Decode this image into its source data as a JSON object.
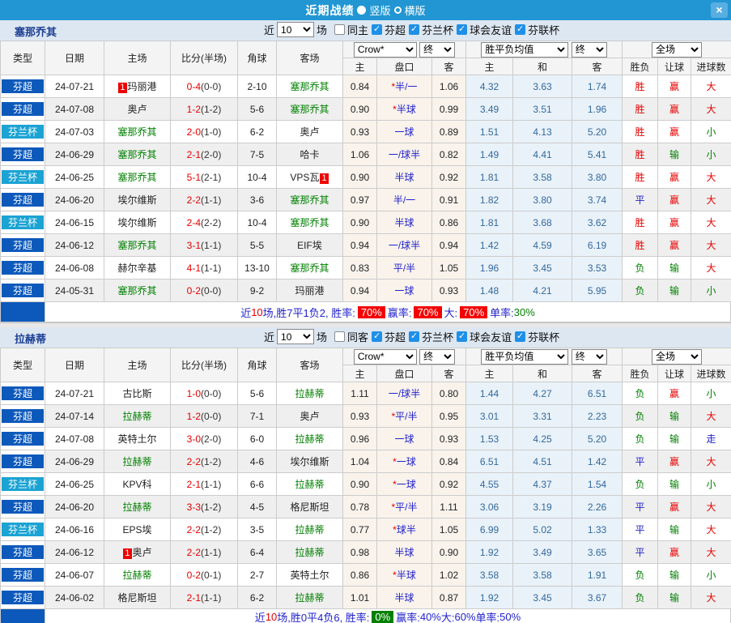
{
  "titlebar": {
    "title": "近期战绩",
    "radio_selected_label": "竖版",
    "radio_unselected_label": "横版",
    "close_label": "×"
  },
  "filter": {
    "near": "近",
    "rounds": "10",
    "matches": "场",
    "leagues": [
      "芬超",
      "芬兰杯",
      "球会友谊",
      "芬联杯"
    ]
  },
  "cols": {
    "type": "类型",
    "date": "日期",
    "home": "主场",
    "score": "比分(半场)",
    "corner": "角球",
    "away": "客场",
    "crow_option": "Crow*",
    "final_option": "终",
    "avg_option": "胜平负均值",
    "scope_option": "全场",
    "odds_home": "主",
    "handicap": "盘口",
    "odds_away": "客",
    "avg_home": "主",
    "avg_draw": "和",
    "avg_away": "客",
    "result": "胜负",
    "let_ball": "让球",
    "goals": "进球数"
  },
  "sections": [
    {
      "team": "塞那乔其",
      "same_side_label": "同主",
      "rows": [
        {
          "lg": "芬超",
          "lgc": "super",
          "date": "24-07-21",
          "home": "玛丽港",
          "home_green": false,
          "home_badge": "before",
          "score": "0-4",
          "half": "(0-0)",
          "corner": "2-10",
          "away": "塞那乔其",
          "away_green": true,
          "away_badge": null,
          "o1": "0.84",
          "star": true,
          "hc": "半/一",
          "o2": "1.06",
          "m1": "4.32",
          "m2": "3.63",
          "m3": "1.74",
          "res": "胜",
          "lr": "赢",
          "gr": "大"
        },
        {
          "lg": "芬超",
          "lgc": "super",
          "date": "24-07-08",
          "home": "奥卢",
          "home_green": false,
          "home_badge": null,
          "score": "1-2",
          "half": "(1-2)",
          "corner": "5-6",
          "away": "塞那乔其",
          "away_green": true,
          "away_badge": null,
          "o1": "0.90",
          "star": true,
          "hc": "半球",
          "o2": "0.99",
          "m1": "3.49",
          "m2": "3.51",
          "m3": "1.96",
          "res": "胜",
          "lr": "赢",
          "gr": "大"
        },
        {
          "lg": "芬兰杯",
          "lgc": "cup",
          "date": "24-07-03",
          "home": "塞那乔其",
          "home_green": true,
          "home_badge": null,
          "score": "2-0",
          "half": "(1-0)",
          "corner": "6-2",
          "away": "奥卢",
          "away_green": false,
          "away_badge": null,
          "o1": "0.93",
          "star": false,
          "hc": "一球",
          "o2": "0.89",
          "m1": "1.51",
          "m2": "4.13",
          "m3": "5.20",
          "res": "胜",
          "lr": "赢",
          "gr": "小"
        },
        {
          "lg": "芬超",
          "lgc": "super",
          "date": "24-06-29",
          "home": "塞那乔其",
          "home_green": true,
          "home_badge": null,
          "score": "2-1",
          "half": "(2-0)",
          "corner": "7-5",
          "away": "哈卡",
          "away_green": false,
          "away_badge": null,
          "o1": "1.06",
          "star": false,
          "hc": "一/球半",
          "o2": "0.82",
          "m1": "1.49",
          "m2": "4.41",
          "m3": "5.41",
          "res": "胜",
          "lr": "输",
          "gr": "小"
        },
        {
          "lg": "芬兰杯",
          "lgc": "cup",
          "date": "24-06-25",
          "home": "塞那乔其",
          "home_green": true,
          "home_badge": null,
          "score": "5-1",
          "half": "(2-1)",
          "corner": "10-4",
          "away": "VPS瓦",
          "away_green": false,
          "away_badge": "after",
          "o1": "0.90",
          "star": false,
          "hc": "半球",
          "o2": "0.92",
          "m1": "1.81",
          "m2": "3.58",
          "m3": "3.80",
          "res": "胜",
          "lr": "赢",
          "gr": "大"
        },
        {
          "lg": "芬超",
          "lgc": "super",
          "date": "24-06-20",
          "home": "埃尔维斯",
          "home_green": false,
          "home_badge": null,
          "score": "2-2",
          "half": "(1-1)",
          "corner": "3-6",
          "away": "塞那乔其",
          "away_green": true,
          "away_badge": null,
          "o1": "0.97",
          "star": false,
          "hc": "半/一",
          "o2": "0.91",
          "m1": "1.82",
          "m2": "3.80",
          "m3": "3.74",
          "res": "平",
          "lr": "赢",
          "gr": "大"
        },
        {
          "lg": "芬兰杯",
          "lgc": "cup",
          "date": "24-06-15",
          "home": "埃尔维斯",
          "home_green": false,
          "home_badge": null,
          "score": "2-4",
          "half": "(2-2)",
          "corner": "10-4",
          "away": "塞那乔其",
          "away_green": true,
          "away_badge": null,
          "o1": "0.90",
          "star": false,
          "hc": "半球",
          "o2": "0.86",
          "m1": "1.81",
          "m2": "3.68",
          "m3": "3.62",
          "res": "胜",
          "lr": "赢",
          "gr": "大"
        },
        {
          "lg": "芬超",
          "lgc": "super",
          "date": "24-06-12",
          "home": "塞那乔其",
          "home_green": true,
          "home_badge": null,
          "score": "3-1",
          "half": "(1-1)",
          "corner": "5-5",
          "away": "EIF埃",
          "away_green": false,
          "away_badge": null,
          "o1": "0.94",
          "star": false,
          "hc": "一/球半",
          "o2": "0.94",
          "m1": "1.42",
          "m2": "4.59",
          "m3": "6.19",
          "res": "胜",
          "lr": "赢",
          "gr": "大"
        },
        {
          "lg": "芬超",
          "lgc": "super",
          "date": "24-06-08",
          "home": "赫尔辛基",
          "home_green": false,
          "home_badge": null,
          "score": "4-1",
          "half": "(1-1)",
          "corner": "13-10",
          "away": "塞那乔其",
          "away_green": true,
          "away_badge": null,
          "o1": "0.83",
          "star": false,
          "hc": "平/半",
          "o2": "1.05",
          "m1": "1.96",
          "m2": "3.45",
          "m3": "3.53",
          "res": "负",
          "lr": "输",
          "gr": "大"
        },
        {
          "lg": "芬超",
          "lgc": "super",
          "date": "24-05-31",
          "home": "塞那乔其",
          "home_green": true,
          "home_badge": null,
          "score": "0-2",
          "half": "(0-0)",
          "corner": "9-2",
          "away": "玛丽港",
          "away_green": false,
          "away_badge": null,
          "o1": "0.94",
          "star": false,
          "hc": "一球",
          "o2": "0.93",
          "m1": "1.48",
          "m2": "4.21",
          "m3": "5.95",
          "res": "负",
          "lr": "输",
          "gr": "小"
        }
      ],
      "summary": [
        {
          "t": "近"
        },
        {
          "t": "10",
          "c": "red"
        },
        {
          "t": "场,胜7平1负2, 胜率:"
        },
        {
          "t": "70%",
          "badge": "red"
        },
        {
          "t": " 赢率:"
        },
        {
          "t": "70%",
          "badge": "red"
        },
        {
          "t": " 大:"
        },
        {
          "t": "70%",
          "badge": "red"
        },
        {
          "t": " 单率:"
        },
        {
          "t": "30%",
          "c": "green"
        }
      ]
    },
    {
      "team": "拉赫蒂",
      "same_side_label": "同客",
      "rows": [
        {
          "lg": "芬超",
          "lgc": "super",
          "date": "24-07-21",
          "home": "古比斯",
          "home_green": false,
          "home_badge": null,
          "score": "1-0",
          "half": "(0-0)",
          "corner": "5-6",
          "away": "拉赫蒂",
          "away_green": true,
          "away_badge": null,
          "o1": "1.11",
          "star": false,
          "hc": "一/球半",
          "o2": "0.80",
          "m1": "1.44",
          "m2": "4.27",
          "m3": "6.51",
          "res": "负",
          "lr": "赢",
          "gr": "小"
        },
        {
          "lg": "芬超",
          "lgc": "super",
          "date": "24-07-14",
          "home": "拉赫蒂",
          "home_green": true,
          "home_badge": null,
          "score": "1-2",
          "half": "(0-0)",
          "corner": "7-1",
          "away": "奥卢",
          "away_green": false,
          "away_badge": null,
          "o1": "0.93",
          "star": true,
          "hc": "平/半",
          "o2": "0.95",
          "m1": "3.01",
          "m2": "3.31",
          "m3": "2.23",
          "res": "负",
          "lr": "输",
          "gr": "大"
        },
        {
          "lg": "芬超",
          "lgc": "super",
          "date": "24-07-08",
          "home": "英特土尔",
          "home_green": false,
          "home_badge": null,
          "score": "3-0",
          "half": "(2-0)",
          "corner": "6-0",
          "away": "拉赫蒂",
          "away_green": true,
          "away_badge": null,
          "o1": "0.96",
          "star": false,
          "hc": "一球",
          "o2": "0.93",
          "m1": "1.53",
          "m2": "4.25",
          "m3": "5.20",
          "res": "负",
          "lr": "输",
          "gr": "走"
        },
        {
          "lg": "芬超",
          "lgc": "super",
          "date": "24-06-29",
          "home": "拉赫蒂",
          "home_green": true,
          "home_badge": null,
          "score": "2-2",
          "half": "(1-2)",
          "corner": "4-6",
          "away": "埃尔维斯",
          "away_green": false,
          "away_badge": null,
          "o1": "1.04",
          "star": true,
          "hc": "一球",
          "o2": "0.84",
          "m1": "6.51",
          "m2": "4.51",
          "m3": "1.42",
          "res": "平",
          "lr": "赢",
          "gr": "大"
        },
        {
          "lg": "芬兰杯",
          "lgc": "cup",
          "date": "24-06-25",
          "home": "KPV科",
          "home_green": false,
          "home_badge": null,
          "score": "2-1",
          "half": "(1-1)",
          "corner": "6-6",
          "away": "拉赫蒂",
          "away_green": true,
          "away_badge": null,
          "o1": "0.90",
          "star": true,
          "hc": "一球",
          "o2": "0.92",
          "m1": "4.55",
          "m2": "4.37",
          "m3": "1.54",
          "res": "负",
          "lr": "输",
          "gr": "小"
        },
        {
          "lg": "芬超",
          "lgc": "super",
          "date": "24-06-20",
          "home": "拉赫蒂",
          "home_green": true,
          "home_badge": null,
          "score": "3-3",
          "half": "(1-2)",
          "corner": "4-5",
          "away": "格尼斯坦",
          "away_green": false,
          "away_badge": null,
          "o1": "0.78",
          "star": true,
          "hc": "平/半",
          "o2": "1.11",
          "m1": "3.06",
          "m2": "3.19",
          "m3": "2.26",
          "res": "平",
          "lr": "赢",
          "gr": "大"
        },
        {
          "lg": "芬兰杯",
          "lgc": "cup",
          "date": "24-06-16",
          "home": "EPS埃",
          "home_green": false,
          "home_badge": null,
          "score": "2-2",
          "half": "(1-2)",
          "corner": "3-5",
          "away": "拉赫蒂",
          "away_green": true,
          "away_badge": null,
          "o1": "0.77",
          "star": true,
          "hc": "球半",
          "o2": "1.05",
          "m1": "6.99",
          "m2": "5.02",
          "m3": "1.33",
          "res": "平",
          "lr": "输",
          "gr": "大"
        },
        {
          "lg": "芬超",
          "lgc": "super",
          "date": "24-06-12",
          "home": "奥卢",
          "home_green": false,
          "home_badge": "before",
          "score": "2-2",
          "half": "(1-1)",
          "corner": "6-4",
          "away": "拉赫蒂",
          "away_green": true,
          "away_badge": null,
          "o1": "0.98",
          "star": false,
          "hc": "半球",
          "o2": "0.90",
          "m1": "1.92",
          "m2": "3.49",
          "m3": "3.65",
          "res": "平",
          "lr": "赢",
          "gr": "大"
        },
        {
          "lg": "芬超",
          "lgc": "super",
          "date": "24-06-07",
          "home": "拉赫蒂",
          "home_green": true,
          "home_badge": null,
          "score": "0-2",
          "half": "(0-1)",
          "corner": "2-7",
          "away": "英特土尔",
          "away_green": false,
          "away_badge": null,
          "o1": "0.86",
          "star": true,
          "hc": "半球",
          "o2": "1.02",
          "m1": "3.58",
          "m2": "3.58",
          "m3": "1.91",
          "res": "负",
          "lr": "输",
          "gr": "小"
        },
        {
          "lg": "芬超",
          "lgc": "super",
          "date": "24-06-02",
          "home": "格尼斯坦",
          "home_green": false,
          "home_badge": null,
          "score": "2-1",
          "half": "(1-1)",
          "corner": "6-2",
          "away": "拉赫蒂",
          "away_green": true,
          "away_badge": null,
          "o1": "1.01",
          "star": false,
          "hc": "半球",
          "o2": "0.87",
          "m1": "1.92",
          "m2": "3.45",
          "m3": "3.67",
          "res": "负",
          "lr": "输",
          "gr": "大"
        }
      ],
      "summary": [
        {
          "t": "近"
        },
        {
          "t": "10",
          "c": "red"
        },
        {
          "t": "场,胜0平4负6, 胜率:"
        },
        {
          "t": "0%",
          "badge": "green"
        },
        {
          "t": " 赢率:"
        },
        {
          "t": "40%",
          "c": "blue"
        },
        {
          "t": " 大:"
        },
        {
          "t": "60%",
          "c": "blue"
        },
        {
          "t": " 单率:"
        },
        {
          "t": "50%",
          "c": "blue"
        }
      ]
    }
  ],
  "red_card_badge": "1",
  "colors": {
    "titlebar": "#2196d3",
    "league_super": "#0d59bb",
    "league_cup": "#1ba3d3",
    "win_red": "#e60000",
    "draw_blue": "#2222cc",
    "lose_green": "#008000",
    "avg_bg": "#e9f2f9",
    "odds_bg": "#f9f3ec",
    "filter_bg": "#dde7f2"
  }
}
